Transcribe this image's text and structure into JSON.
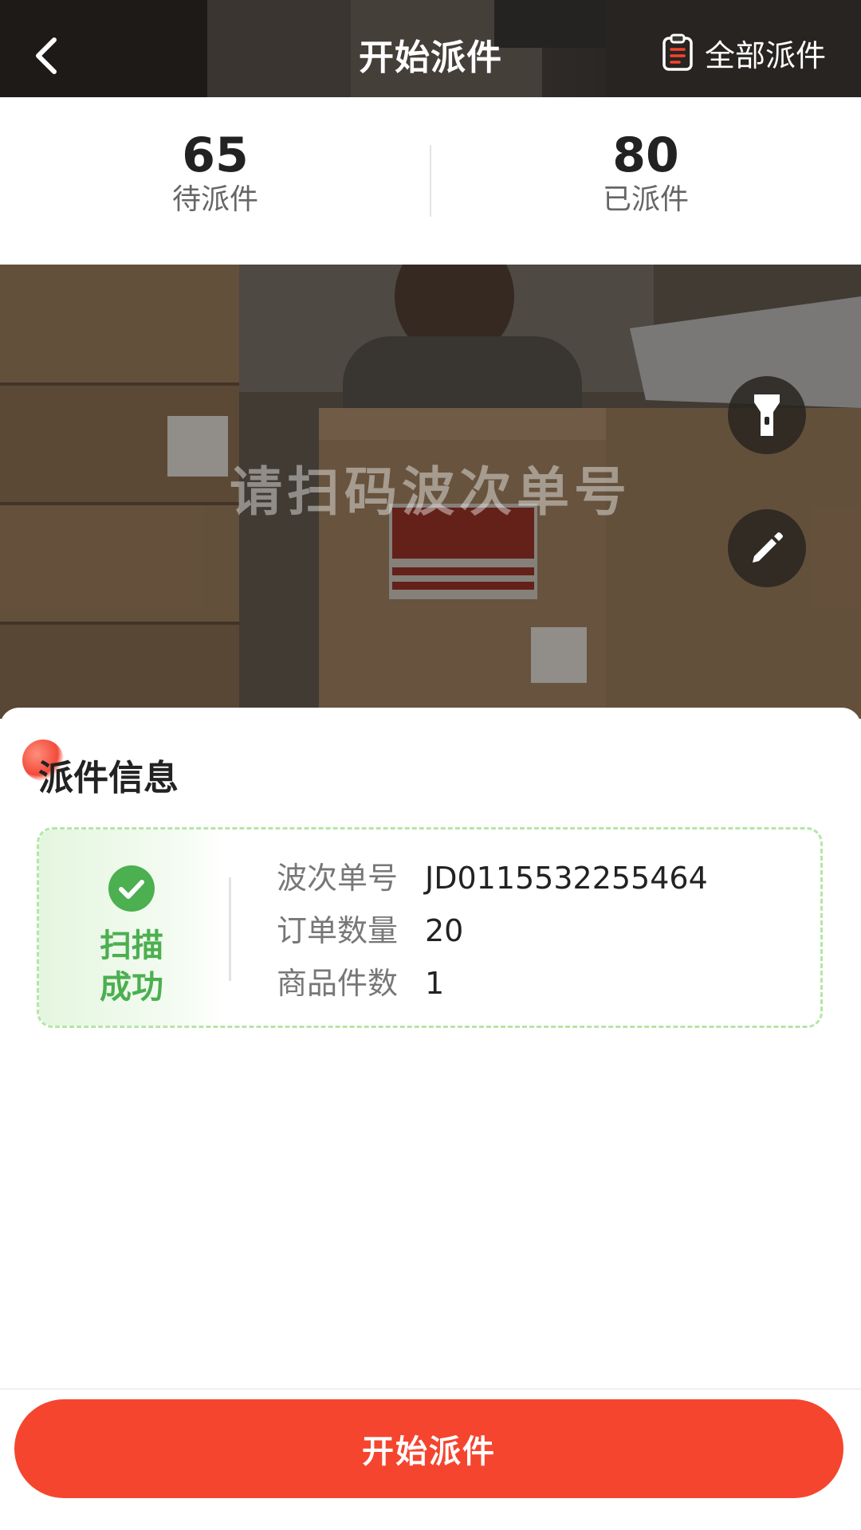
{
  "header": {
    "title": "开始派件",
    "back_icon": "chevron-left-icon",
    "right_action": {
      "icon": "clipboard-list-icon",
      "label": "全部派件"
    }
  },
  "stats": {
    "pending": {
      "value": "65",
      "label": "待派件"
    },
    "dispatched": {
      "value": "80",
      "label": "已派件"
    }
  },
  "scanner": {
    "hint": "请扫码波次单号",
    "flashlight_icon": "flashlight-icon",
    "manual_input_icon": "pencil-icon"
  },
  "dispatch_info": {
    "title": "派件信息",
    "status": {
      "icon": "check-circle-icon",
      "text": "扫描\n成功"
    },
    "rows": [
      {
        "label": "波次单号",
        "value": "JD0115532255464"
      },
      {
        "label": "订单数量",
        "value": "20"
      },
      {
        "label": "商品件数",
        "value": "1"
      }
    ]
  },
  "primary_button": {
    "label": "开始派件"
  },
  "colors": {
    "accent": "#F5452F",
    "success": "#4CAF50",
    "success_border": "#B4E6A6"
  }
}
